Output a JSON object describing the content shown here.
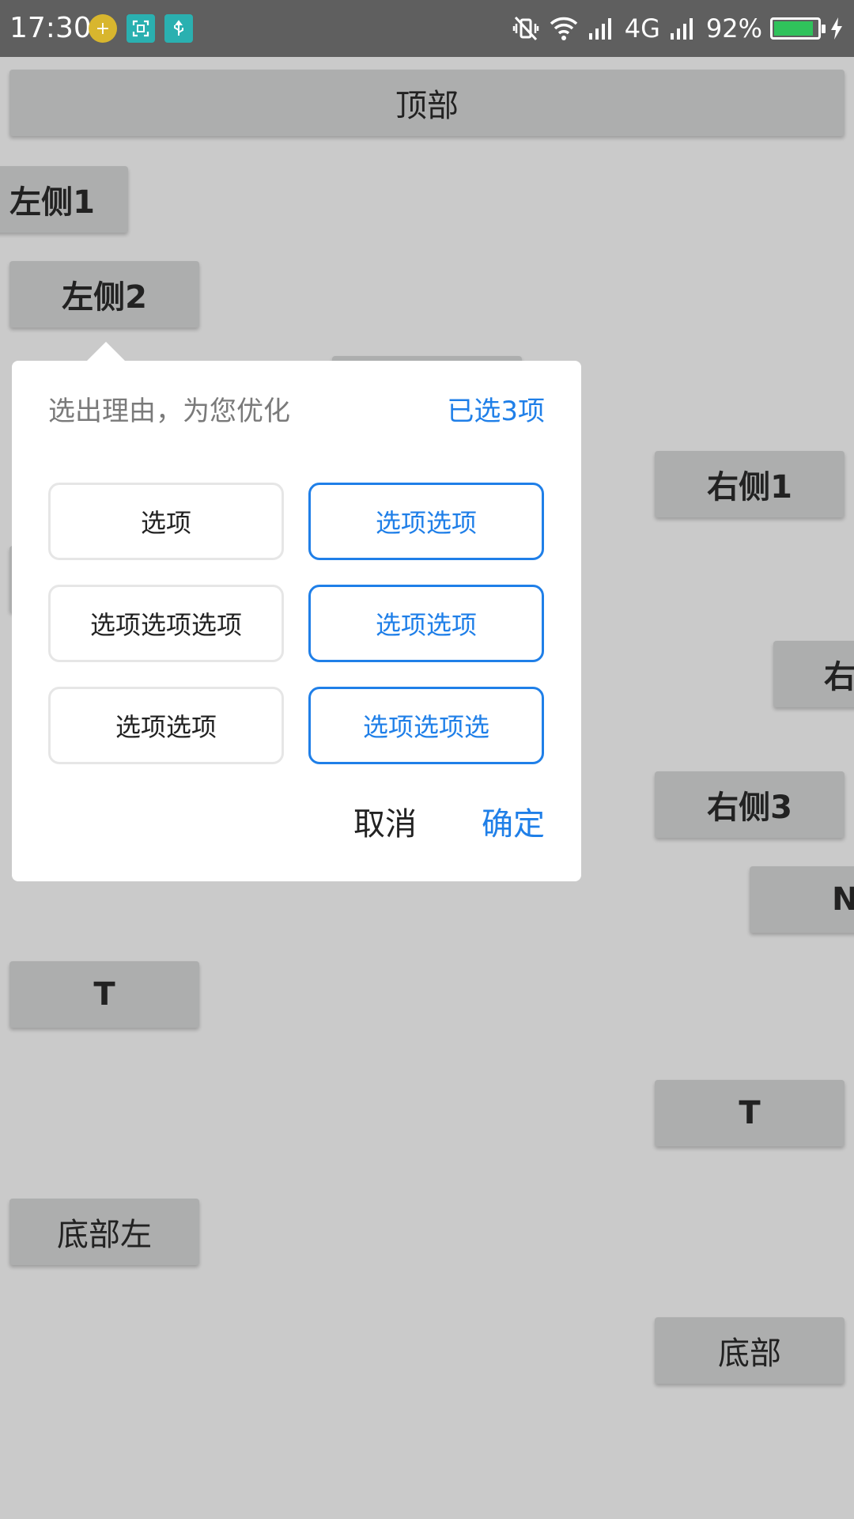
{
  "status_bar": {
    "time": "17:30",
    "network": "4G",
    "battery_percent": "92%",
    "battery_level": 0.92,
    "battery_color": "#2fc25b",
    "app_icons": [
      "green-plus-app-icon",
      "screenshot-icon",
      "usb-icon"
    ],
    "right_icons": [
      "vibrate-icon",
      "wifi-icon",
      "signal-icon",
      "signal-icon",
      "battery-icon",
      "charging-icon"
    ]
  },
  "buttons": {
    "top": "顶部",
    "left1": "左侧1",
    "left2": "左侧2",
    "right1": "右侧1",
    "right2": "右",
    "right3": "右侧3",
    "right_n": "N",
    "t_left": "T",
    "t_right": "T",
    "bottom_left": "底部左",
    "bottom": "底部"
  },
  "popup": {
    "title": "选出理由，为您优化",
    "selected_count": "已选3项",
    "options": [
      {
        "label": "选项",
        "selected": false
      },
      {
        "label": "选项选项",
        "selected": true
      },
      {
        "label": "选项选项选项",
        "selected": false
      },
      {
        "label": "选项选项",
        "selected": true
      },
      {
        "label": "选项选项",
        "selected": false
      },
      {
        "label": "选项选项选",
        "selected": true
      }
    ],
    "cancel": "取消",
    "confirm": "确定",
    "accent_color": "#1f7fe8"
  }
}
